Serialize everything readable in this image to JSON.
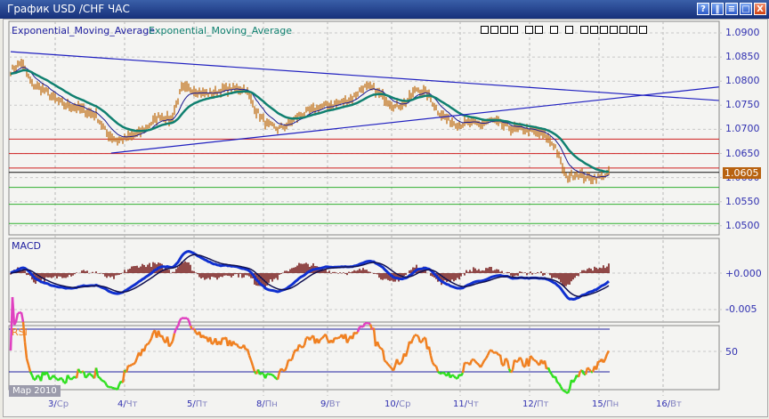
{
  "window": {
    "title": "График USD /CHF  ЧАС",
    "buttons": [
      "?",
      "‖",
      "≡",
      "□",
      "X"
    ]
  },
  "legend": {
    "ema1": "Exponential_Moving_Average",
    "ema2": "Exponential_Moving_Average"
  },
  "panels": {
    "macd": "MACD",
    "rsi": "RSI"
  },
  "axis": {
    "price": [
      "1.0900",
      "1.0850",
      "1.0800",
      "1.0750",
      "1.0700",
      "1.0650",
      "1.0600",
      "1.0550",
      "1.0500"
    ],
    "macd": [
      "+0.000",
      "-0.005"
    ],
    "rsi": [
      "50"
    ]
  },
  "last_price": "1.0605",
  "month_label": "Мар 2010",
  "dates": [
    {
      "d": "3/",
      "w": "Ср"
    },
    {
      "d": "4/",
      "w": "Чт"
    },
    {
      "d": "5/",
      "w": "Пт"
    },
    {
      "d": "8/",
      "w": "Пн"
    },
    {
      "d": "9/",
      "w": "Вт"
    },
    {
      "d": "10/",
      "w": "Ср"
    },
    {
      "d": "11/",
      "w": "Чт"
    },
    {
      "d": "12/",
      "w": "Пт"
    },
    {
      "d": "15/",
      "w": "Пн"
    },
    {
      "d": "16/",
      "w": "Вт"
    }
  ],
  "colors": {
    "candle": "#c07018",
    "ema1": "#1a1a90",
    "ema2": "#108070",
    "trend": "#2020c0",
    "red": "#d02020",
    "green": "#30b030",
    "macd": "#1030d0",
    "hist": "#701010",
    "rsi": "#f08020"
  },
  "chart_data": {
    "type": "line",
    "ylim": [
      1.0495,
      1.0905
    ],
    "price": [
      1.0821,
      1.0839,
      1.0793,
      1.0784,
      1.0765,
      1.0751,
      1.0747,
      1.0738,
      1.0729,
      1.0692,
      1.0677,
      1.0683,
      1.0692,
      1.071,
      1.0729,
      1.0719,
      1.0784,
      1.0784,
      1.0775,
      1.0775,
      1.0784,
      1.0784,
      1.0784,
      1.0738,
      1.071,
      1.0701,
      1.071,
      1.0729,
      1.0738,
      1.0747,
      1.0751,
      1.0756,
      1.0765,
      1.0788,
      1.0784,
      1.0765,
      1.0747,
      1.0756,
      1.0784,
      1.0775,
      1.0738,
      1.0719,
      1.071,
      1.0714,
      1.071,
      1.0719,
      1.071,
      1.0701,
      1.0701,
      1.0695,
      1.0688,
      1.0664,
      1.06,
      1.0609,
      1.06,
      1.06,
      1.0609
    ],
    "hlines": [
      {
        "price": 1.068,
        "color": "red"
      },
      {
        "price": 1.065,
        "color": "red"
      },
      {
        "price": 1.062,
        "color": "red"
      },
      {
        "price": 1.0611,
        "color": "black"
      },
      {
        "price": 1.058,
        "color": "green"
      },
      {
        "price": 1.0545,
        "color": "green"
      },
      {
        "price": 1.0505,
        "color": "green"
      }
    ],
    "trendlines": [
      {
        "i0": 0,
        "p0": 1.0861,
        "i1": 66.3,
        "p1": 1.076
      },
      {
        "i0": 9.4,
        "p0": 1.0651,
        "i1": 66.3,
        "p1": 1.0788
      }
    ],
    "rsi_levels": [
      70,
      30
    ]
  }
}
